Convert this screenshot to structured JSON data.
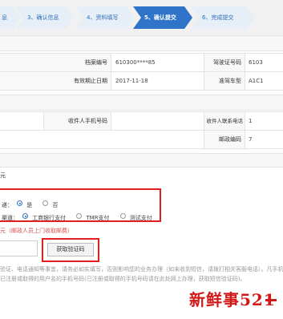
{
  "steps": [
    {
      "label": "息"
    },
    {
      "label": "3、确认信息"
    },
    {
      "label": "4、资料填写"
    },
    {
      "label": "5、确认提交"
    },
    {
      "label": "6、完成提交"
    }
  ],
  "info": {
    "archive_no_label": "档案编号",
    "archive_no_value": "610300****85",
    "license_no_label": "驾驶证号码",
    "license_no_value": "6103",
    "valid_until_label": "有效期止日期",
    "valid_until_value": "2017-11-18",
    "vehicle_type_label": "准驾车型",
    "vehicle_type_value": "A1C1"
  },
  "recipient": {
    "phone_label": "收件人手机号码",
    "contact_phone_label": "收件人联系电话",
    "contact_phone_value": "1",
    "postcode_label": "邮政编码",
    "postcode_value": "7"
  },
  "fee_text": "元",
  "payment": {
    "mail_label": "递：",
    "mail_yes": "是",
    "mail_no": "否",
    "method_label": "渠道：",
    "methods": [
      "工商银行支付",
      "TMR支付",
      "测试支付"
    ]
  },
  "postal_fee_text": "元（邮政人员上门收取邮费）",
  "code_button": "获取验证码",
  "notice": {
    "line1a": "验证、电话通知等事宜",
    "line1b": "，请务必如实填写，否则影响您的业务办理（如未收到短信，请拨打相关客服电话）。凡手机号码无",
    "line2": "已注册或取得的用户名的手机号码(已注册或取得的手机号码请在此处网上办理，获取短信验证码)。"
  },
  "watermark": "新鲜事521"
}
